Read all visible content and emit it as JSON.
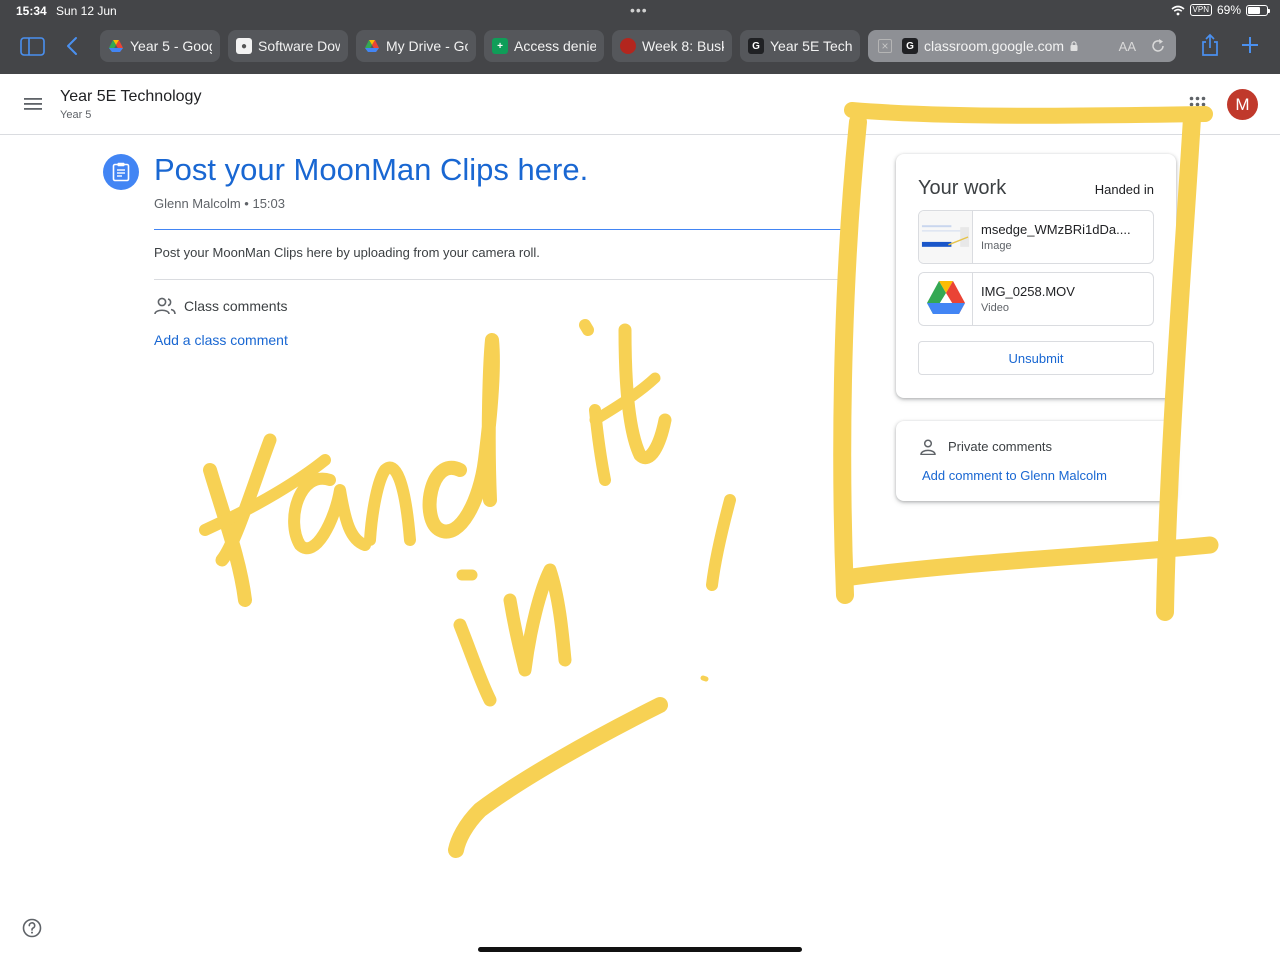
{
  "status_bar": {
    "time": "15:34",
    "date": "Sun 12 Jun",
    "vpn": "VPN",
    "battery": "69%",
    "battery_level": 0.69
  },
  "browser": {
    "tabs": [
      {
        "label": "Year 5 - Goog",
        "favicon": "google-drive-icon"
      },
      {
        "label": "Software Dow",
        "favicon": "apple-icon"
      },
      {
        "label": "My Drive - Go",
        "favicon": "google-drive-icon"
      },
      {
        "label": "Access denie",
        "favicon": "google-sheets-icon"
      },
      {
        "label": "Week 8: Busk",
        "favicon": "red-favicon-icon"
      },
      {
        "label": "Year 5E Techn",
        "favicon": "g-letter-icon"
      }
    ],
    "active_tab": {
      "url": "classroom.google.com",
      "favicon_letter": "G",
      "aa": "AA"
    }
  },
  "classroom": {
    "class_name": "Year 5E Technology",
    "class_section": "Year 5",
    "avatar_initial": "M",
    "avatar_color": "#c0392b"
  },
  "assignment": {
    "title": "Post your MoonMan Clips here.",
    "author_time": "Glenn Malcolm • 15:03",
    "description": "Post your MoonMan Clips here by uploading from your camera roll.",
    "class_comments_label": "Class comments",
    "add_class_comment": "Add a class comment"
  },
  "your_work": {
    "title": "Your work",
    "status": "Handed in",
    "attachments": [
      {
        "name": "msedge_WMzBRi1dDa....",
        "type": "Image"
      },
      {
        "name": "IMG_0258.MOV",
        "type": "Video"
      }
    ],
    "unsubmit_label": "Unsubmit"
  },
  "private_comments": {
    "label": "Private comments",
    "add_label": "Add comment to Glenn Malcolm"
  },
  "colors": {
    "accent_blue": "#1967d2",
    "annotation_yellow": "#f7d154",
    "chrome_bg": "#444548"
  }
}
